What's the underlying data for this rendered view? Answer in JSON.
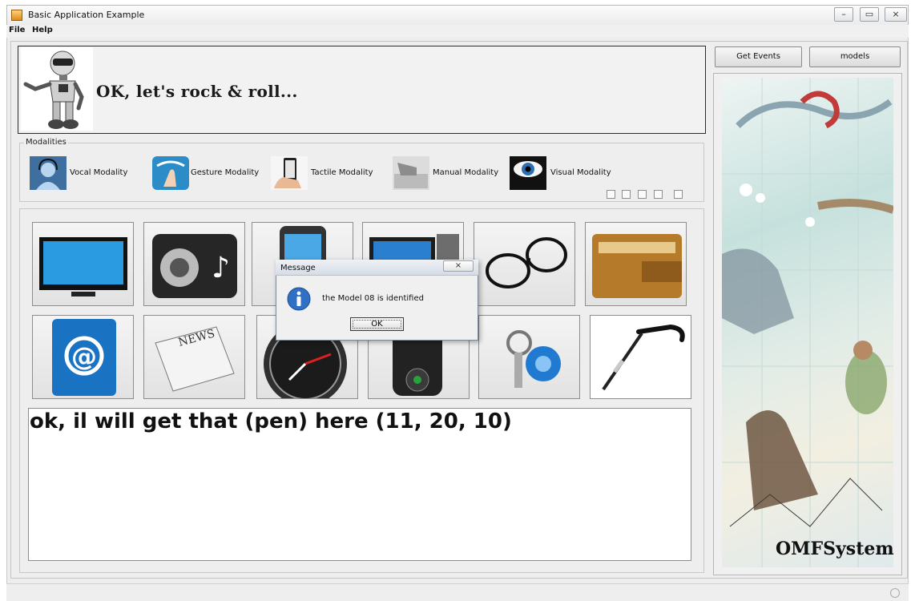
{
  "window": {
    "title": "Basic Application Example",
    "minimize": "–",
    "maximize": "▭",
    "close": "×"
  },
  "menu": {
    "file": "File",
    "help": "Help"
  },
  "header": {
    "text": "OK, let's rock & roll..."
  },
  "modalities": {
    "group_label": "Modalities",
    "items": [
      {
        "label": "Vocal Modality",
        "icon": "headset-icon"
      },
      {
        "label": "Gesture Modality",
        "icon": "swipe-hand-icon"
      },
      {
        "label": "Tactile Modality",
        "icon": "phone-touch-icon"
      },
      {
        "label": "Manual Modality",
        "icon": "keyboard-hand-icon"
      },
      {
        "label": "Visual Modality",
        "icon": "eye-icon"
      }
    ],
    "checkboxes": [
      false,
      false,
      false,
      false,
      false
    ]
  },
  "devices": [
    "tv-icon",
    "speaker-music-icon",
    "mobile-phone-icon",
    "computer-monitor-icon",
    "glasses-icon",
    "wallet-icon",
    "address-book-icon",
    "newspaper-icon",
    "clock-icon",
    "remote-control-icon",
    "keys-icon",
    "walking-cane-icon"
  ],
  "output": {
    "text": "ok, il will get that (pen) here (11, 20, 10)"
  },
  "buttons": {
    "get_events": "Get Events",
    "models": "models"
  },
  "side_logo": "OMFSystem",
  "dialog": {
    "title": "Message",
    "close": "×",
    "message": "the Model 08 is identified",
    "ok": "OK"
  },
  "colors": {
    "accent": "#3b83c7",
    "dialog_title": "#dbe2ea",
    "panel": "#eeeeee"
  }
}
